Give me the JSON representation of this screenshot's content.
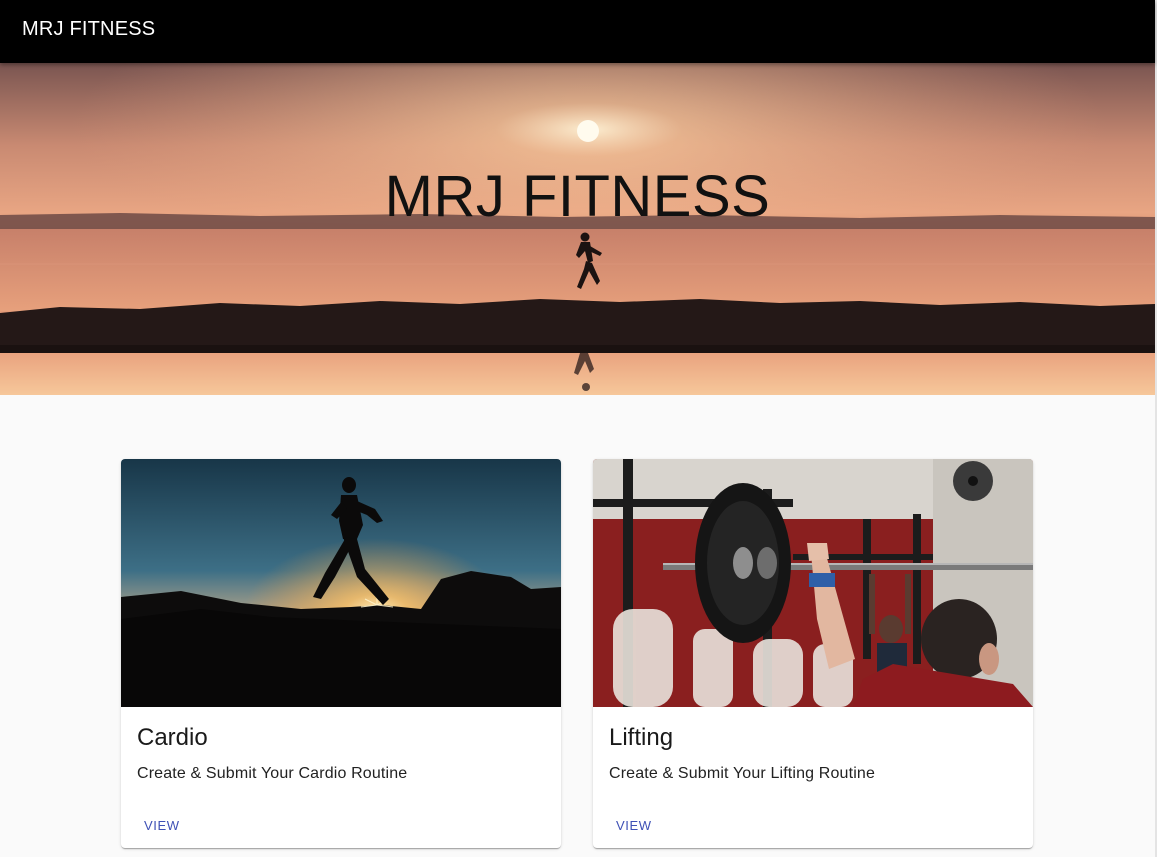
{
  "appbar": {
    "title": "MRJ FITNESS"
  },
  "hero": {
    "title": "MRJ FITNESS",
    "image": "sunset-runner-lake-photo"
  },
  "cards": [
    {
      "title": "Cardio",
      "description": "Create & Submit Your Cardio Routine",
      "button_label": "VIEW",
      "image": "silhouette-runner-sunset-photo"
    },
    {
      "title": "Lifting",
      "description": "Create & Submit Your Lifting Routine",
      "button_label": "VIEW",
      "image": "barbell-overhead-lift-gym-photo"
    }
  ],
  "colors": {
    "appbar_bg": "#000000",
    "appbar_text": "#ffffff",
    "page_bg": "#fafafa",
    "button_text": "#3f51b5"
  }
}
